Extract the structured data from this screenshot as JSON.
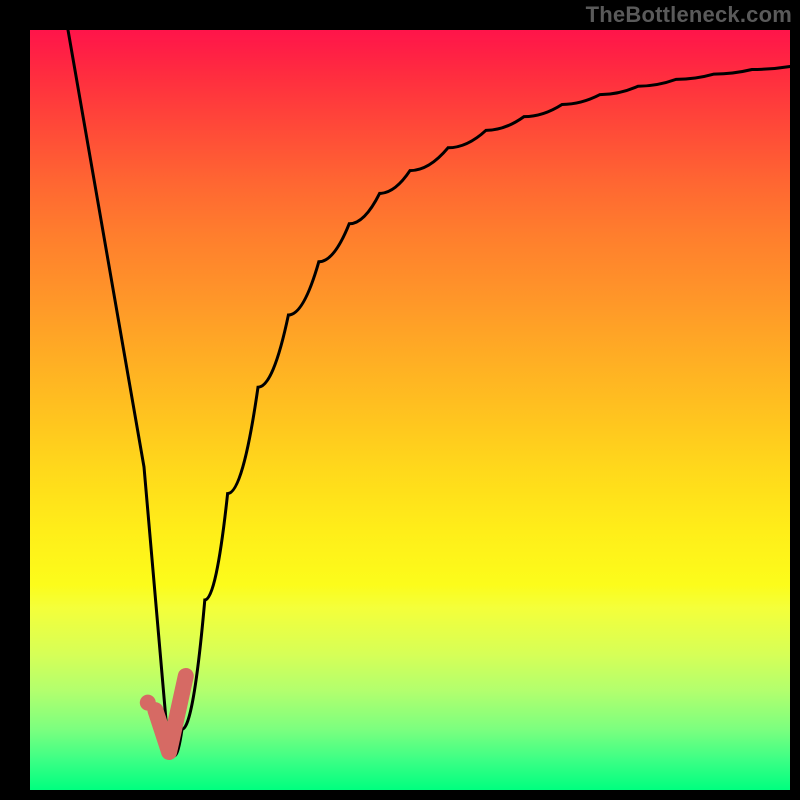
{
  "watermark": "TheBottleneck.com",
  "colors": {
    "curve": "#000000",
    "marker": "#d66a64",
    "gradient_top": "#ff144a",
    "gradient_bottom": "#00ff7f"
  },
  "chart_data": {
    "type": "line",
    "title": "",
    "xlabel": "",
    "ylabel": "",
    "xlim": [
      0,
      100
    ],
    "ylim": [
      0,
      100
    ],
    "x": [
      5,
      7,
      9,
      11,
      13,
      15,
      16,
      17,
      18,
      19,
      20,
      23,
      26,
      30,
      34,
      38,
      42,
      46,
      50,
      55,
      60,
      65,
      70,
      75,
      80,
      85,
      90,
      95,
      100
    ],
    "y": [
      100,
      88.5,
      77,
      65.5,
      54,
      42.5,
      31,
      19.5,
      8,
      4.5,
      8,
      25,
      39,
      53,
      62.5,
      69.5,
      74.5,
      78.5,
      81.5,
      84.5,
      86.8,
      88.6,
      90.2,
      91.5,
      92.6,
      93.5,
      94.2,
      94.8,
      95.2
    ],
    "minimum": {
      "x": 18,
      "y": 4.5
    },
    "marker_tick": [
      {
        "x": 16.5,
        "y": 10.5
      },
      {
        "x": 18.3,
        "y": 5.0
      },
      {
        "x": 20.5,
        "y": 15.0
      }
    ],
    "marker_dot": {
      "x": 15.5,
      "y": 11.5
    }
  }
}
